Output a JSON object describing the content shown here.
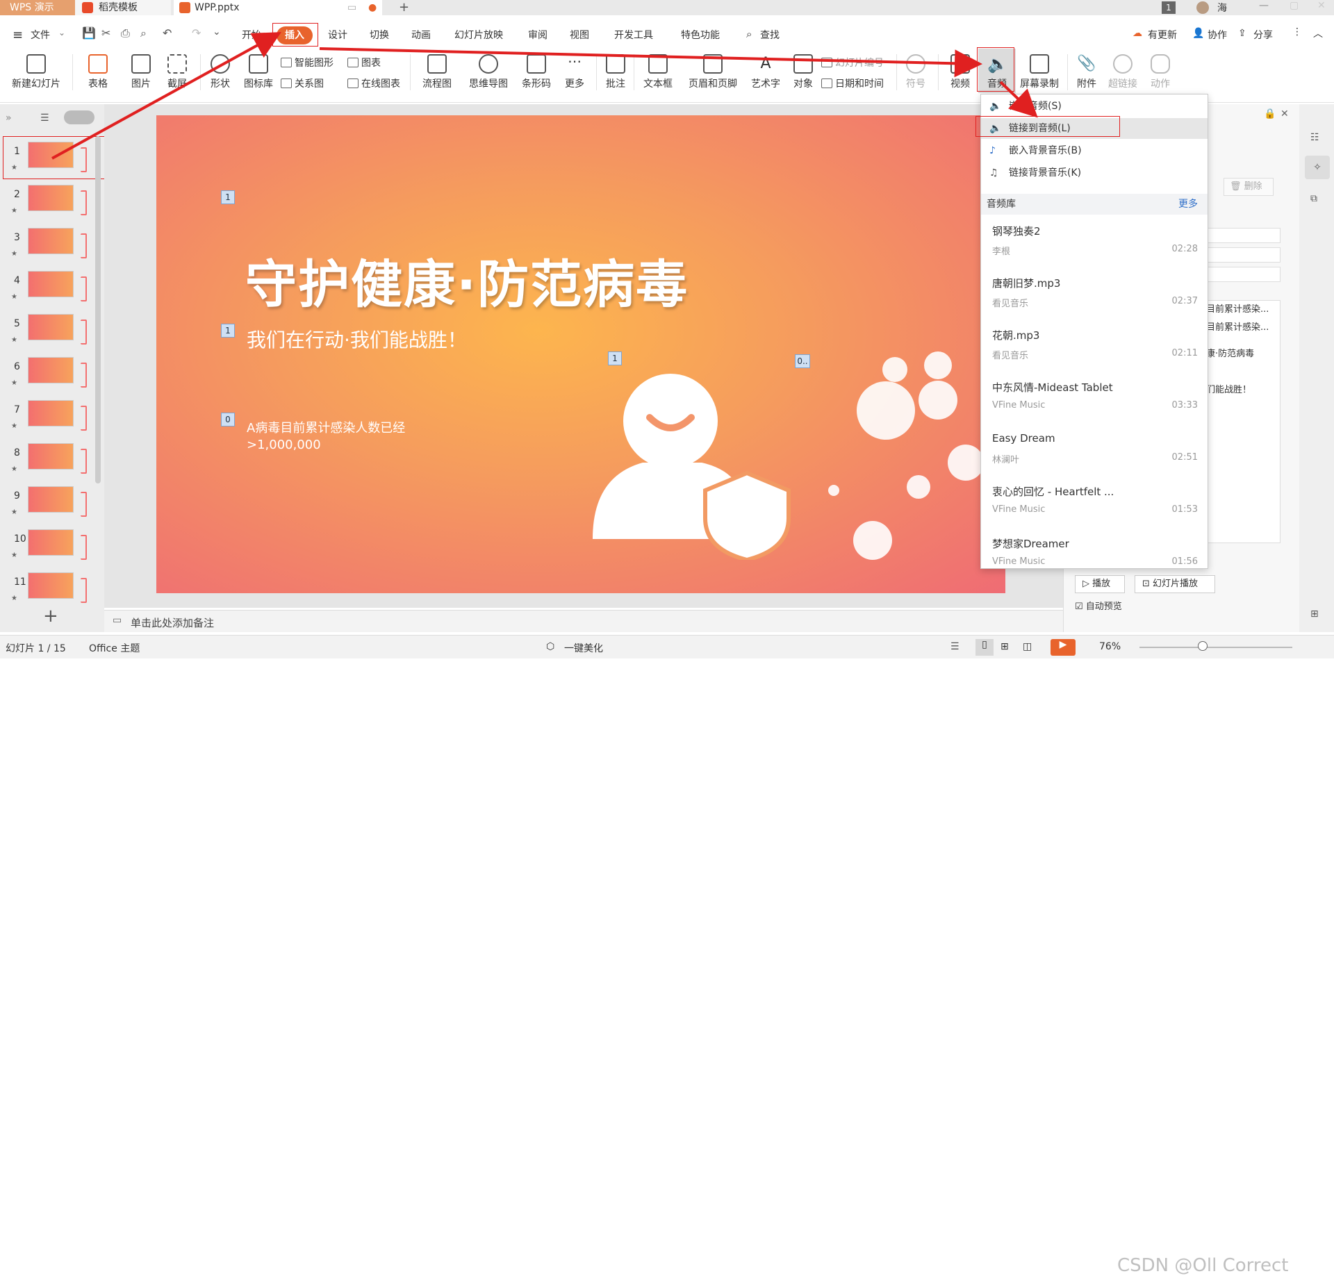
{
  "tabs": {
    "app": "WPS 演示",
    "template": "稻壳模板",
    "doc": "WPP.pptx",
    "page_badge": "1",
    "user": "海"
  },
  "menu": {
    "file": "文件",
    "items": [
      "开始",
      "插入",
      "设计",
      "切换",
      "动画",
      "幻灯片放映",
      "审阅",
      "视图",
      "开发工具",
      "特色功能"
    ],
    "search": "查找",
    "update": "有更新",
    "collab": "协作",
    "share": "分享"
  },
  "ribbon": {
    "new_slide": "新建幻灯片",
    "table": "表格",
    "picture": "图片",
    "screenshot": "截屏",
    "shape": "形状",
    "icon_lib": "图标库",
    "smart_art": "智能图形",
    "chart": "图表",
    "relation": "关系图",
    "online_chart": "在线图表",
    "flow": "流程图",
    "mind": "思维导图",
    "barcode": "条形码",
    "more": "更多",
    "comment": "批注",
    "textbox": "文本框",
    "header_footer": "页眉和页脚",
    "wordart": "艺术字",
    "object": "对象",
    "slide_no": "幻灯片编号",
    "datetime": "日期和时间",
    "symbol": "符号",
    "video": "视频",
    "audio": "音频",
    "screen_rec": "屏幕录制",
    "attach": "附件",
    "hyperlink": "超链接",
    "action": "动作"
  },
  "slides": {
    "numbers": [
      "1",
      "2",
      "3",
      "4",
      "5",
      "6",
      "7",
      "8",
      "9",
      "10",
      "11"
    ],
    "add": "+"
  },
  "slide": {
    "title": "守护健康·防范病毒",
    "subtitle": "我们在行动·我们能战胜！",
    "body_line1": "A病毒目前累计感染人数已经",
    "body_line2": ">1,000,000",
    "ph1": "1",
    "ph2": "1",
    "ph3": "1",
    "ph4": "0..",
    "ph5": "0"
  },
  "notes_placeholder": "单击此处添加备注",
  "audio_menu": {
    "embed_audio": "嵌入音频(S)",
    "link_audio": "链接到音频(L)",
    "embed_bg": "嵌入背景音乐(B)",
    "link_bg": "链接背景音乐(K)",
    "library_title": "音频库",
    "library_more": "更多",
    "library": [
      {
        "title": "钢琴独奏2",
        "artist": "李根",
        "duration": "02:28"
      },
      {
        "title": "唐朝旧梦.mp3",
        "artist": "看见音乐",
        "duration": "02:37"
      },
      {
        "title": "花朝.mp3",
        "artist": "看见音乐",
        "duration": "02:11"
      },
      {
        "title": "中东风情-Mideast Tablet",
        "artist": "VFine Music",
        "duration": "03:33"
      },
      {
        "title": "Easy Dream",
        "artist": "林澜叶",
        "duration": "02:51"
      },
      {
        "title": "衷心的回忆 - Heartfelt ...",
        "artist": "VFine Music",
        "duration": "01:53"
      },
      {
        "title": "梦想家Dreamer",
        "artist": "VFine Music",
        "duration": "01:56"
      }
    ]
  },
  "right_pane": {
    "delete": "删除",
    "text1": "目前累计感染...",
    "text2": "目前累计感染...",
    "text3": "康·防范病毒",
    "text4": "们能战胜！",
    "play": "播放",
    "slideshow": "幻灯片播放",
    "autopreview": "自动预览"
  },
  "status": {
    "slide_info": "幻灯片 1 / 15",
    "theme": "Office 主题",
    "beautify": "一键美化",
    "zoom": "76%",
    "watermark": "CSDN @Oll Correct"
  },
  "colors": {
    "accent": "#e8632c",
    "highlight_red": "#e02020"
  }
}
